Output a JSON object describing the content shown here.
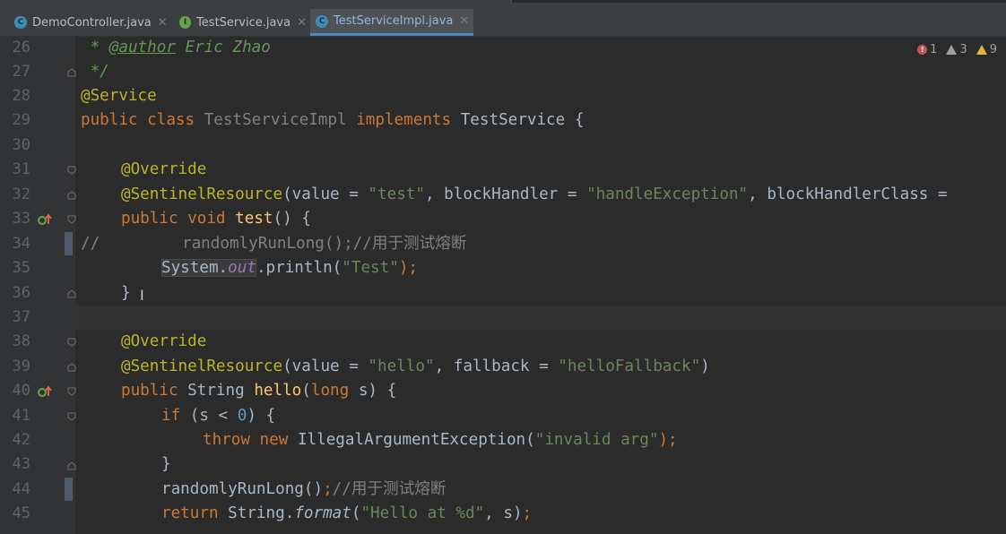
{
  "tabs": [
    {
      "name": "DemoController.java",
      "icon": "class-icon",
      "active": false
    },
    {
      "name": "TestService.java",
      "icon": "interface-icon",
      "active": false
    },
    {
      "name": "TestServiceImpl.java",
      "icon": "class-icon",
      "active": true
    }
  ],
  "inspections": {
    "errors": "1",
    "weak_warnings": "3",
    "warnings": "9"
  },
  "line_numbers": [
    "26",
    "27",
    "28",
    "29",
    "30",
    "31",
    "32",
    "33",
    "34",
    "35",
    "36",
    "37",
    "38",
    "39",
    "40",
    "41",
    "42",
    "43",
    "44",
    "45"
  ],
  "code": {
    "l26_star": " * ",
    "l26_tag": "@author",
    "l26_text": " Eric Zhao",
    "l27": " */",
    "l28": "@Service",
    "l29_kw1": "public class ",
    "l29_name": "TestServiceImpl ",
    "l29_kw2": "implements ",
    "l29_rest": "TestService {",
    "l31": "@Override",
    "l32_an": "@SentinelResource",
    "l32_a": "(value = ",
    "l32_s1": "\"test\"",
    "l32_b": ", blockHandler = ",
    "l32_s2": "\"handleException\"",
    "l32_c": ", blockHandlerClass = ",
    "l33_kw": "public void ",
    "l33_fn": "test",
    "l33_rest": "() {",
    "l34_cmt": "//",
    "l34_text": "randomlyRunLong();//用于测试熔断",
    "l35_sys": "System.",
    "l35_out": "out",
    "l35_a": ".println(",
    "l35_s": "\"Test\"",
    "l35_b": ");",
    "l36": "}",
    "l38": "@Override",
    "l39_an": "@SentinelResource",
    "l39_a": "(value = ",
    "l39_s1": "\"hello\"",
    "l39_b": ", fallback = ",
    "l39_s2": "\"helloFallback\"",
    "l39_c": ")",
    "l40_kw": "public ",
    "l40_type": "String ",
    "l40_fn": "hello",
    "l40_a": "(",
    "l40_kw2": "long ",
    "l40_b": "s) {",
    "l41_kw": "if ",
    "l41_a": "(s < ",
    "l41_num": "0",
    "l41_b": ") {",
    "l42_kw": "throw new ",
    "l42_a": "IllegalArgumentException(",
    "l42_s": "\"invalid arg\"",
    "l42_b": ");",
    "l43": "}",
    "l44_a": "randomlyRunLong()",
    "l44_semi": ";",
    "l44_cmt": "//用于测试熔断",
    "l45_kw": "return ",
    "l45_a": "String.",
    "l45_fmt": "format",
    "l45_b": "(",
    "l45_s": "\"Hello at %d\"",
    "l45_c": ", s)",
    "l45_semi": ";"
  }
}
